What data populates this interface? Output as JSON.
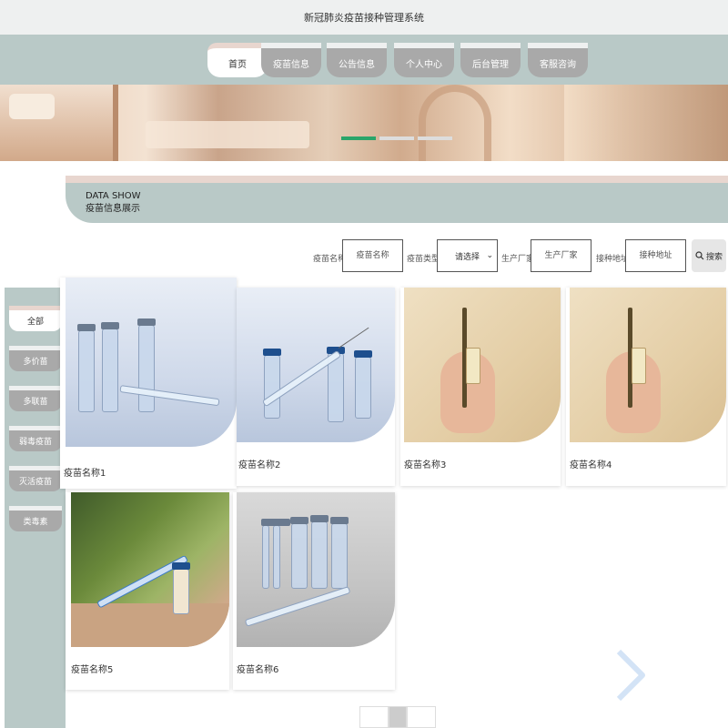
{
  "app_title": "新冠肺炎疫苗接种管理系统",
  "nav": {
    "items": [
      {
        "label": "首页",
        "active": true
      },
      {
        "label": "疫苗信息",
        "active": false
      },
      {
        "label": "公告信息",
        "active": false
      },
      {
        "label": "个人中心",
        "active": false
      },
      {
        "label": "后台管理",
        "active": false
      },
      {
        "label": "客服咨询",
        "active": false
      }
    ]
  },
  "banner": {
    "dots": [
      {
        "active": true
      },
      {
        "active": false
      },
      {
        "active": false
      }
    ],
    "accent_color": "#2aa56a"
  },
  "section": {
    "title_en": "DATA SHOW",
    "title_cn": "疫苗信息展示"
  },
  "search": {
    "name_label": "疫苗名称",
    "name_placeholder": "疫苗名称",
    "type_label": "疫苗类型",
    "type_selected": "请选择",
    "maker_label": "生产厂家",
    "maker_placeholder": "生产厂家",
    "address_label": "接种地址",
    "address_placeholder": "接种地址",
    "button_label": "搜索",
    "button_icon": "search-icon"
  },
  "sidebar": {
    "items": [
      {
        "label": "全部",
        "active": true
      },
      {
        "label": "多价苗",
        "active": false
      },
      {
        "label": "多联苗",
        "active": false
      },
      {
        "label": "弱毒疫苗",
        "active": false
      },
      {
        "label": "灭活疫苗",
        "active": false
      },
      {
        "label": "类毒素",
        "active": false
      }
    ]
  },
  "products": [
    {
      "name": "疫苗名称1",
      "image": "vials-syringe-blue"
    },
    {
      "name": "疫苗名称2",
      "image": "vials-syringe-light"
    },
    {
      "name": "疫苗名称3",
      "image": "hand-vial"
    },
    {
      "name": "疫苗名称4",
      "image": "hand-vial"
    },
    {
      "name": "疫苗名称5",
      "image": "syringe-green"
    },
    {
      "name": "疫苗名称6",
      "image": "vials-gray"
    }
  ],
  "colors": {
    "nav_bg": "#b9c9c7",
    "tab_inactive": "#a9a9a9",
    "tab_accent": "#e8d6cf"
  }
}
